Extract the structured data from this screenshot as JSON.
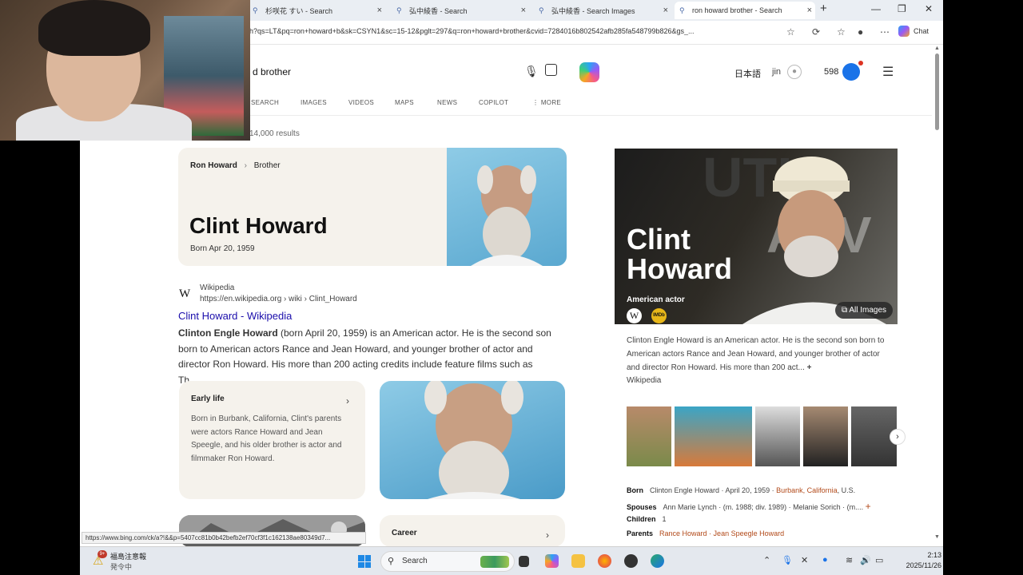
{
  "browser": {
    "tabs": [
      {
        "label": "杉咲花 すい - Search"
      },
      {
        "label": "弘中綾香 - Search"
      },
      {
        "label": "弘中綾香 - Search Images"
      },
      {
        "label": "ron howard brother - Search"
      }
    ],
    "new_tab_symbol": "+",
    "url": "h?qs=LT&pq=ron+howard+b&sk=CSYN1&sc=15-12&pglt=297&q=ron+howard+brother&cvid=7284016b802542afb285fa548799b826&gs_...",
    "chat_label": "Chat"
  },
  "search": {
    "query": "d brother",
    "language": "日本語",
    "user": "jin",
    "points": "598",
    "tabs": [
      "SEARCH",
      "IMAGES",
      "VIDEOS",
      "MAPS",
      "NEWS",
      "COPILOT",
      "MORE"
    ],
    "results_count": "14,000 results"
  },
  "hero": {
    "crumb_parent": "Ron Howard",
    "crumb_child": "Brother",
    "name": "Clint Howard",
    "born": "Born Apr 20, 1959"
  },
  "wiki_result": {
    "source": "Wikipedia",
    "url": "https://en.wikipedia.org › wiki › Clint_Howard",
    "title": "Clint Howard - Wikipedia",
    "snippet_bold": "Clinton Engle Howard",
    "snippet_rest": " (born April 20, 1959) is an American actor. He is the second son born to American actors Rance and Jean Howard, and younger brother of actor and director Ron Howard. His more than 200 acting credits include feature films such as Th..."
  },
  "early_life": {
    "title": "Early life",
    "text": "Born in Burbank, California, Clint's parents were actors Rance Howard and Jean Speegle, and his older brother is actor and filmmaker Ron Howard."
  },
  "career": {
    "title": "Career"
  },
  "knowledge_panel": {
    "name": "Clint Howard",
    "description": "American actor",
    "all_images": "All Images",
    "imdb": "IMDb",
    "summary": "Clinton Engle Howard is an American actor. He is the second son born to American actors Rance and Jean Howard, and younger brother of actor and director Ron Howard. His more than 200 act...",
    "summary_more": "+",
    "summary_source": "Wikipedia",
    "facts": {
      "born_label": "Born",
      "born_value": "Clinton Engle Howard · April 20, 1959 · ",
      "born_place": "Burbank, California",
      "born_country": ", U.S.",
      "spouses_label": "Spouses",
      "spouses_value": "Ann Marie Lynch · (m. 1988; div. 1989) · Melanie Sorich · (m....",
      "children_label": "Children",
      "children_value": "1",
      "parents_label": "Parents",
      "parents_value": "Rance Howard · Jean Speegle Howard"
    }
  },
  "status_url": "https://www.bing.com/ck/a?!&&p=5407cc81b0b42befb2ef70cf3f1c162138ae80349d7...",
  "taskbar": {
    "weather_badge": "9+",
    "weather_title": "福島注意報",
    "weather_sub": "発令中",
    "search_label": "Search",
    "time": "2:13",
    "date": "2025/11/26"
  },
  "colors": {
    "link_blue": "#1a0dab",
    "fact_link": "#b24a1a",
    "card_bg": "#f5f2ec"
  }
}
